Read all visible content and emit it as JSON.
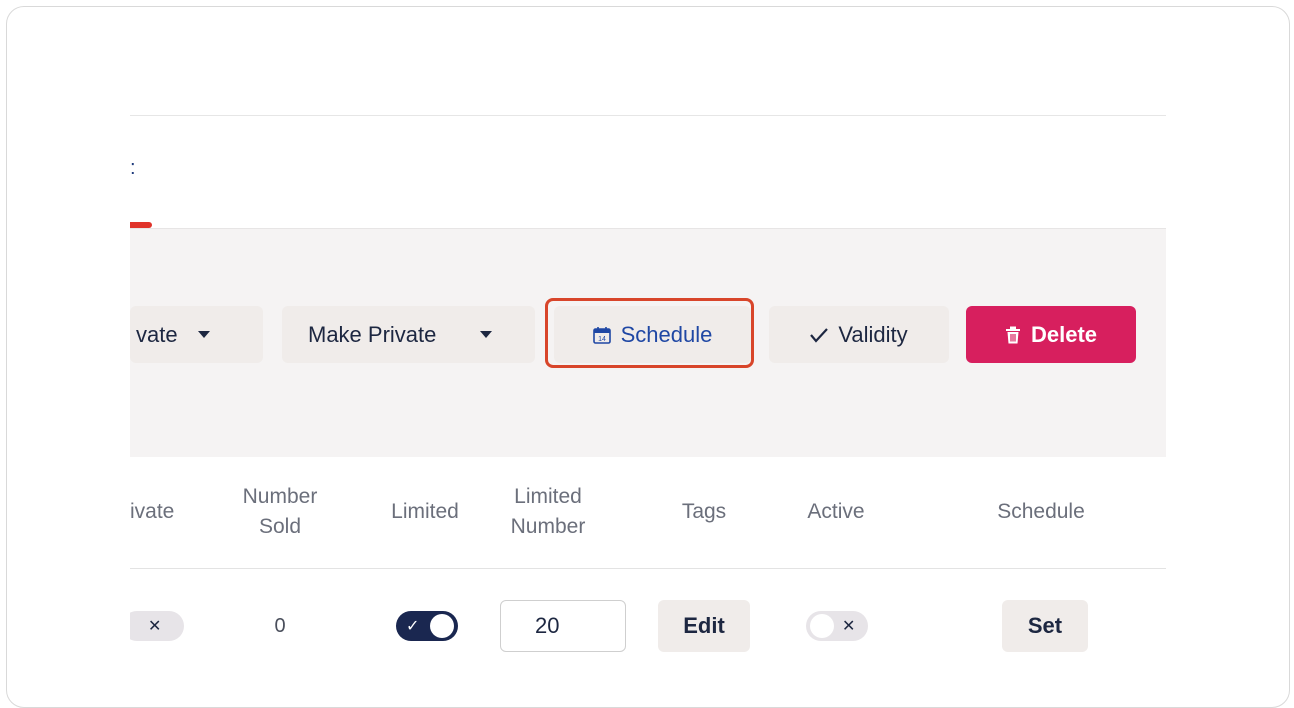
{
  "tab_fragment": ":",
  "toolbar": {
    "private_label": "vate",
    "make_private_label": "Make Private",
    "schedule_label": "Schedule",
    "validity_label": "Validity",
    "delete_label": "Delete"
  },
  "table": {
    "headers": [
      {
        "key": "private",
        "label": "ivate"
      },
      {
        "key": "number_sold",
        "label": "Number\nSold"
      },
      {
        "key": "limited",
        "label": "Limited"
      },
      {
        "key": "limited_number",
        "label": "Limited\nNumber"
      },
      {
        "key": "tags",
        "label": "Tags"
      },
      {
        "key": "active",
        "label": "Active"
      },
      {
        "key": "schedule",
        "label": "Schedule"
      }
    ],
    "row": {
      "number_sold": "0",
      "limited_number_value": "20",
      "tags_button": "Edit",
      "schedule_button": "Set"
    }
  },
  "colors": {
    "accent": "#1f47a4",
    "delete": "#d71f5e",
    "highlight": "#d8452a",
    "toggle_on": "#1a2750"
  },
  "icons": {
    "schedule": "calendar-icon",
    "validity": "check-icon",
    "delete": "trash-icon"
  }
}
